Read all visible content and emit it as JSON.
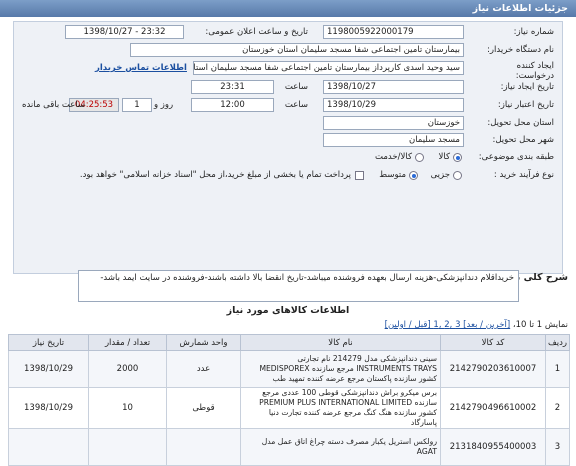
{
  "header": {
    "title": "جزئیات اطلاعات نیاز"
  },
  "form": {
    "need_number_label": "شماره نیاز:",
    "need_number": "1198005922000179",
    "announce_label": "تاریخ و ساعت اعلان عمومی:",
    "announce_value": "1398/10/27 - 23:32",
    "buyer_org_label": "نام دستگاه خریدار:",
    "buyer_org": "بیمارستان تامین اجتماعی شفا مسجد سلیمان استان خوزستان",
    "creator_label": "ایجاد کننده درخواست:",
    "creator": "سید وحید اسدی کارپرداز بیمارستان تامین اجتماعی شفا مسجد سلیمان استان",
    "contact_link": "اطلاعات تماس خریدار",
    "created_date_label": "تاریخ ایجاد نیاز:",
    "created_date": "1398/10/27",
    "time_label": "ساعت",
    "created_time": "23:31",
    "deadline_label": "تاریخ اعتبار نیاز:",
    "deadline_date": "1398/10/29",
    "deadline_time": "12:00",
    "day_label": "روز و",
    "days": "1",
    "timer": "04:25:53",
    "remaining_label": "ساعت باقی مانده",
    "province_label": "استان محل تحویل:",
    "province": "خوزستان",
    "city_label": "شهر محل تحویل:",
    "city": "مسجد سلیمان",
    "category_label": "طبقه بندی موضوعی:",
    "cat_goods": "کالا",
    "cat_service": "کالا/خدمت",
    "purchase_type_label": "نوع فرآیند خرید :",
    "pt_partial": "جزیی",
    "pt_medium": "متوسط",
    "payment_note": "پرداخت تمام یا بخشی از مبلغ خرید،از محل \"اسناد خزانه اسلامی\" خواهد بود."
  },
  "description": {
    "label": "شرح کلی نیاز:",
    "text": "خریداقلام دندانپزشکی-هزینه ارسال بعهده فروشنده میباشد-تاریخ انقضا بالا داشته باشند-فروشنده در سایت ایمد باشد-"
  },
  "goods": {
    "title": "اطلاعات کالاهای مورد نیاز",
    "pager_prefix": "نمایش 1 تا 10،",
    "pager_pages": "[آخرین / بعد] 3 ,2 ,1 [قبل / اولین]",
    "columns": [
      "ردیف",
      "کد کالا",
      "نام کالا",
      "واحد شمارش",
      "تعداد / مقدار",
      "تاریخ نیاز"
    ],
    "rows": [
      {
        "row": "1",
        "code": "2142790203610007",
        "name": "سینی دندانپزشکی مدل 214279 نام تجارتی INSTRUMENTS TRAYS مرجع سازنده MEDISPOREX کشور سازنده پاکستان مرجع عرضه کننده تمهید طب",
        "unit": "عدد",
        "qty": "2000",
        "date": "1398/10/29"
      },
      {
        "row": "2",
        "code": "2142790496610002",
        "name": "برس میکرو براش دندانپزشکی قوطی 100 عددی مرجع سازنده PREMIUM PLUS INTERNATIONAL LIMITED کشور سازنده هنگ کنگ مرجع عرضه کننده تجارت دنیا پاسارگاد",
        "unit": "قوطی",
        "qty": "10",
        "date": "1398/10/29"
      },
      {
        "row": "3",
        "code": "2131840955400003",
        "name": "رولکس استریل یکبار مصرف دسته چراغ اتاق عمل مدل AGAT",
        "unit": "",
        "qty": "",
        "date": ""
      }
    ]
  }
}
